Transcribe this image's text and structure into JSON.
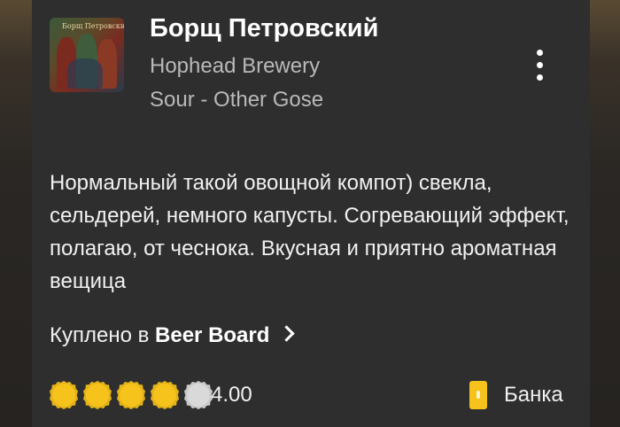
{
  "checkin": {
    "beer_name": "Борщ Петровский",
    "brewery": "Hophead Brewery",
    "style": "Sour - Other Gose",
    "label_image_text": "Борщ Петровский",
    "review": "Нормальный такой овощной компот) свекла, сельдерей, немного капусты. Согревающий эффект, полагаю, от чеснока. Вкусная и приятно ароматная вещица",
    "purchase": {
      "prefix": "Куплено в",
      "venue": "Beer Board"
    },
    "rating": {
      "value": 4.0,
      "display": "4.00",
      "max": 5
    },
    "serving": {
      "label": "Банка",
      "icon": "can-icon"
    },
    "menu_icon": "more-vertical-icon"
  },
  "colors": {
    "background": "#2e2e2e",
    "rating_filled": "#f6c21c",
    "rating_empty": "#d9d9d9",
    "serving_icon": "#f6c21c",
    "text_primary": "#ffffff",
    "text_secondary": "#b9b9b9"
  }
}
